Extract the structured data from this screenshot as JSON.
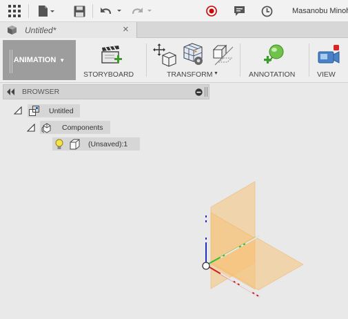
{
  "quick_access": {
    "icons": [
      "app-grid-icon",
      "file-icon",
      "save-icon",
      "undo-icon",
      "redo-icon",
      "record-icon",
      "comment-icon",
      "history-clock-icon"
    ],
    "user_name": "Masanobu Minoh"
  },
  "document_tab": {
    "title": "Untitled*",
    "close_label": "×"
  },
  "ribbon": {
    "workspace_label": "ANIMATION",
    "storyboard_label": "STORYBOARD",
    "transform_label": "TRANSFORM",
    "annotation_label": "ANNOTATION",
    "view_label": "VIEW"
  },
  "browser": {
    "title": "BROWSER",
    "tree": [
      {
        "label": "Untitled",
        "icon": "assembly-icon"
      },
      {
        "label": "Components",
        "icon": "components-icon"
      },
      {
        "label": "(Unsaved):1",
        "icon": "component-body-icon"
      }
    ]
  },
  "colors": {
    "workspace_button": "#9d9d9d",
    "plane_fill": "#f5c27a",
    "axis_x": "#cc2020",
    "axis_y": "#2fbf2f",
    "axis_z": "#1f2fbf"
  }
}
